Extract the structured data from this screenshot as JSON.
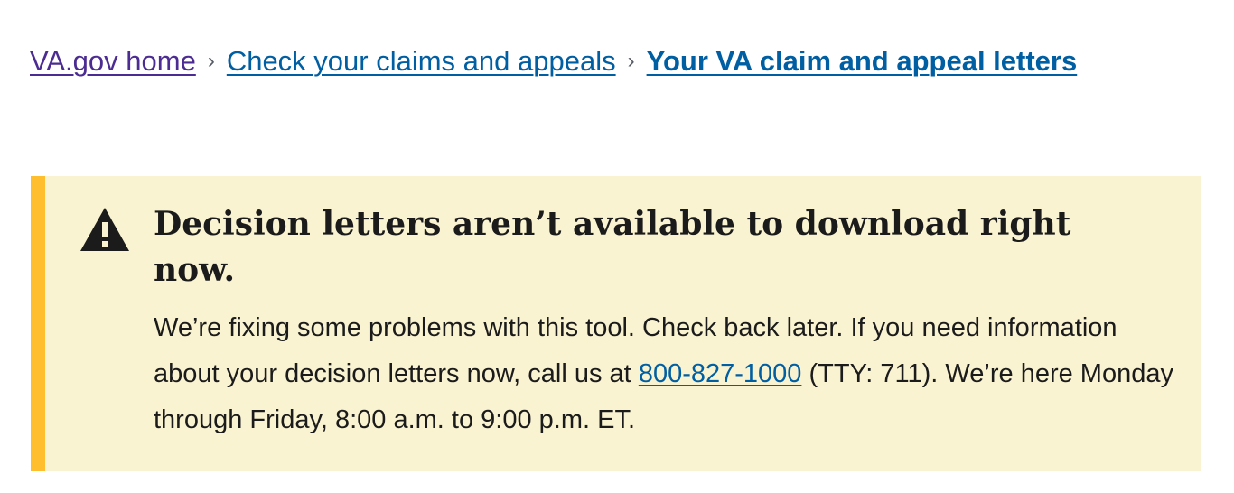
{
  "breadcrumb": {
    "items": [
      {
        "label": "VA.gov home"
      },
      {
        "label": "Check your claims and appeals"
      },
      {
        "label": "Your VA claim and appeal letters"
      }
    ],
    "separator": "›"
  },
  "alert": {
    "type": "warning",
    "icon": "warning-triangle-icon",
    "heading": "Decision letters aren’t available to download right now.",
    "body_before_phone": "We’re fixing some problems with this tool. Check back later. If you need information about your decision letters now, call us at ",
    "phone": "800-827-1000",
    "body_after_phone": " (TTY: 711). We’re here Monday through Friday, 8:00 a.m. to 9:00 p.m. ET."
  },
  "colors": {
    "visited_link": "#4c2c92",
    "link": "#005ea2",
    "alert_background": "#faf3d1",
    "alert_border": "#ffbe2e",
    "text": "#1b1b1b"
  }
}
